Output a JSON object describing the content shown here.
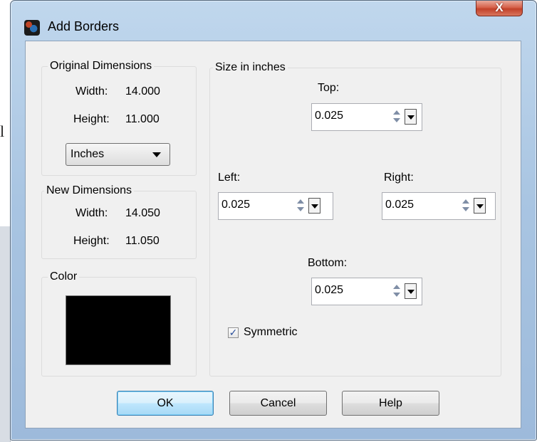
{
  "background": {
    "clipped_letter": "l"
  },
  "dialog": {
    "title": "Add Borders",
    "close_glyph": "X",
    "original_dimensions": {
      "title": "Original Dimensions",
      "width_label": "Width:",
      "width_value": "14.000",
      "height_label": "Height:",
      "height_value": "11.000",
      "units_selected": "Inches"
    },
    "new_dimensions": {
      "title": "New Dimensions",
      "width_label": "Width:",
      "width_value": "14.050",
      "height_label": "Height:",
      "height_value": "11.050"
    },
    "color": {
      "title": "Color",
      "swatch_color": "#000000"
    },
    "size": {
      "title": "Size in inches",
      "top_label": "Top:",
      "top_value": "0.025",
      "left_label": "Left:",
      "left_value": "0.025",
      "right_label": "Right:",
      "right_value": "0.025",
      "bottom_label": "Bottom:",
      "bottom_value": "0.025",
      "symmetric_label": "Symmetric",
      "symmetric_checked": true
    },
    "buttons": {
      "ok": "OK",
      "cancel": "Cancel",
      "help": "Help"
    }
  }
}
